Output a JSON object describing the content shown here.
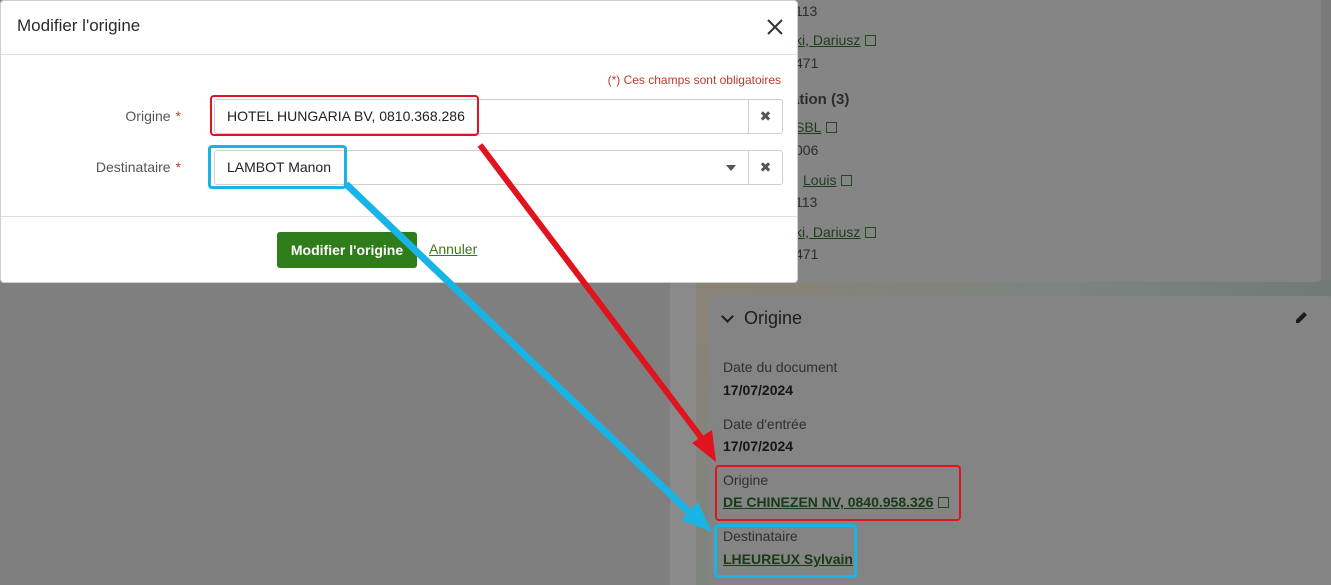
{
  "background": {
    "top_card": {
      "rows": [
        {
          "text": "113"
        },
        {
          "text": "ki, Dariusz",
          "link": true
        },
        {
          "text": "471"
        },
        {
          "text": "ation (3)",
          "bold": true
        },
        {
          "text": "SBL",
          "link": true
        },
        {
          "text": "006"
        },
        {
          "text": "Louis",
          "link": true
        },
        {
          "text": "113"
        },
        {
          "text": "ki, Dariusz",
          "link": true
        },
        {
          "text": "471"
        }
      ]
    },
    "origin_panel": {
      "title": "Origine",
      "fields": {
        "date_document_label": "Date du document",
        "date_document_value": "17/07/2024",
        "date_entree_label": "Date d'entrée",
        "date_entree_value": "17/07/2024",
        "origine_label": "Origine",
        "origine_value": "DE CHINEZEN NV, 0840.958.326",
        "destinataire_label": "Destinataire",
        "destinataire_value": "LHEUREUX Sylvain"
      }
    }
  },
  "modal": {
    "title": "Modifier l'origine",
    "required_note": "(*) Ces champs sont obligatoires",
    "origine": {
      "label": "Origine",
      "value": "HOTEL HUNGARIA BV, 0810.368.286"
    },
    "destinataire": {
      "label": "Destinataire",
      "value": "LAMBOT Manon"
    },
    "required_mark": "*",
    "clear_symbol": "✖",
    "submit_label": "Modifier l'origine",
    "cancel_label": "Annuler"
  },
  "annotation_colors": {
    "red": "#e0141e",
    "blue": "#19b4e6"
  }
}
